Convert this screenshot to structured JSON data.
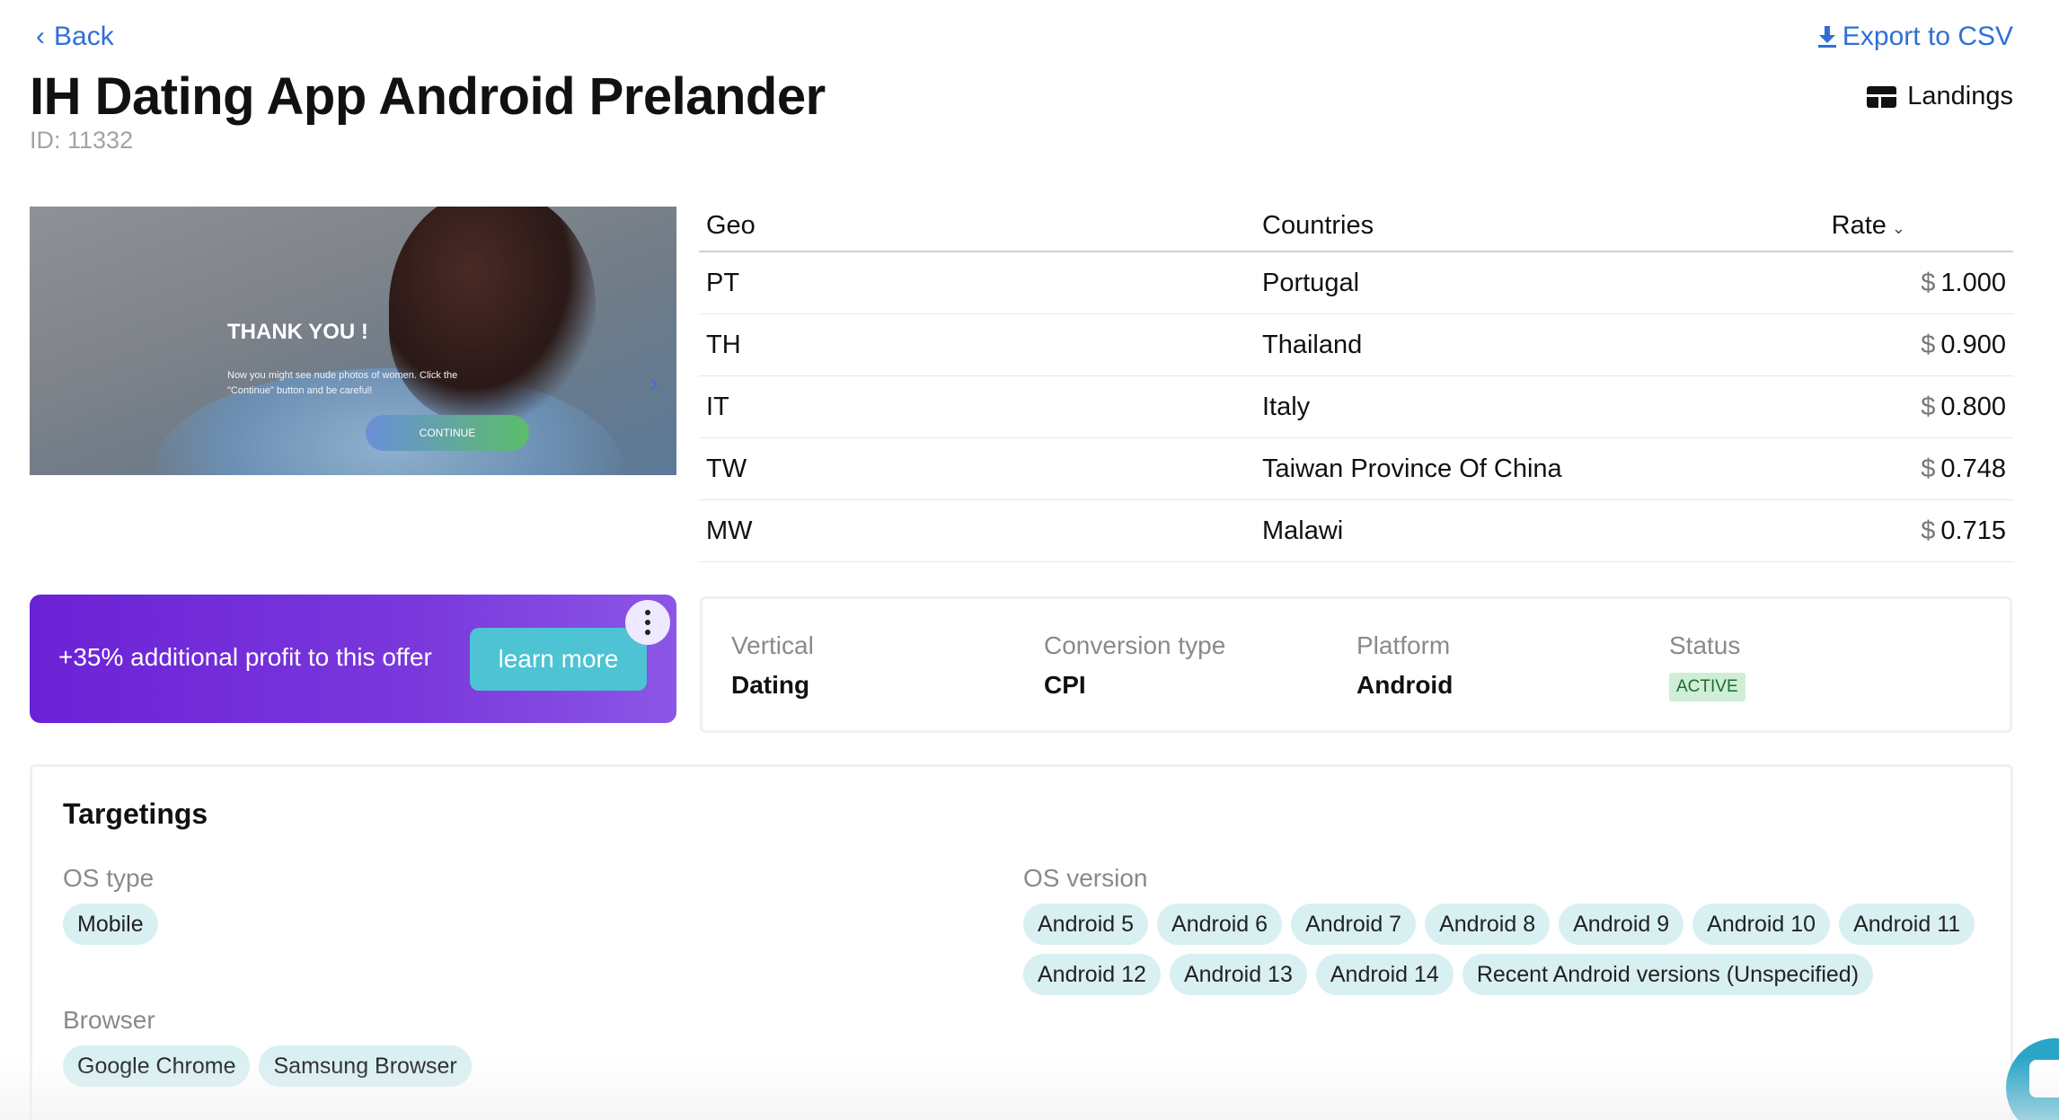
{
  "nav": {
    "back_label": "Back",
    "export_label": "Export to CSV",
    "landings_label": "Landings"
  },
  "offer": {
    "title": "IH Dating App Android Prelander",
    "id_label": "ID: 11332"
  },
  "preview": {
    "heading": "THANK YOU !",
    "text": "Now you might see nude photos of women. Click the \"Continue\" button and be careful!",
    "button": "CONTINUE"
  },
  "geo_table": {
    "headers": {
      "geo": "Geo",
      "countries": "Countries",
      "rate": "Rate"
    },
    "rows": [
      {
        "geo": "PT",
        "country": "Portugal",
        "currency": "$",
        "rate": "1.000"
      },
      {
        "geo": "TH",
        "country": "Thailand",
        "currency": "$",
        "rate": "0.900"
      },
      {
        "geo": "IT",
        "country": "Italy",
        "currency": "$",
        "rate": "0.800"
      },
      {
        "geo": "TW",
        "country": "Taiwan Province Of China",
        "currency": "$",
        "rate": "0.748"
      },
      {
        "geo": "MW",
        "country": "Malawi",
        "currency": "$",
        "rate": "0.715"
      }
    ]
  },
  "promo": {
    "text": "+35% additional profit to this offer",
    "button": "learn more"
  },
  "info": {
    "vertical_label": "Vertical",
    "vertical_value": "Dating",
    "conversion_label": "Conversion type",
    "conversion_value": "CPI",
    "platform_label": "Platform",
    "platform_value": "Android",
    "status_label": "Status",
    "status_value": "ACTIVE"
  },
  "targetings": {
    "title": "Targetings",
    "os_type_label": "OS type",
    "os_type": [
      "Mobile"
    ],
    "os_version_label": "OS version",
    "os_versions": [
      "Android 5",
      "Android 6",
      "Android 7",
      "Android 8",
      "Android 9",
      "Android 10",
      "Android 11",
      "Android 12",
      "Android 13",
      "Android 14",
      "Recent Android versions (Unspecified)"
    ],
    "browser_label": "Browser",
    "browsers": [
      "Google Chrome",
      "Samsung Browser"
    ]
  },
  "colors": {
    "link": "#2f6fd6",
    "promo": "#6b22d6",
    "learn_more": "#4dc3d3",
    "chip": "#d8f0f2",
    "status_badge": "#cfeed5"
  },
  "icons": [
    "chevron-left-icon",
    "download-icon",
    "landings-icon",
    "chevron-right-icon",
    "sort-chevron-icon",
    "kebab-menu-icon",
    "chat-icon"
  ]
}
